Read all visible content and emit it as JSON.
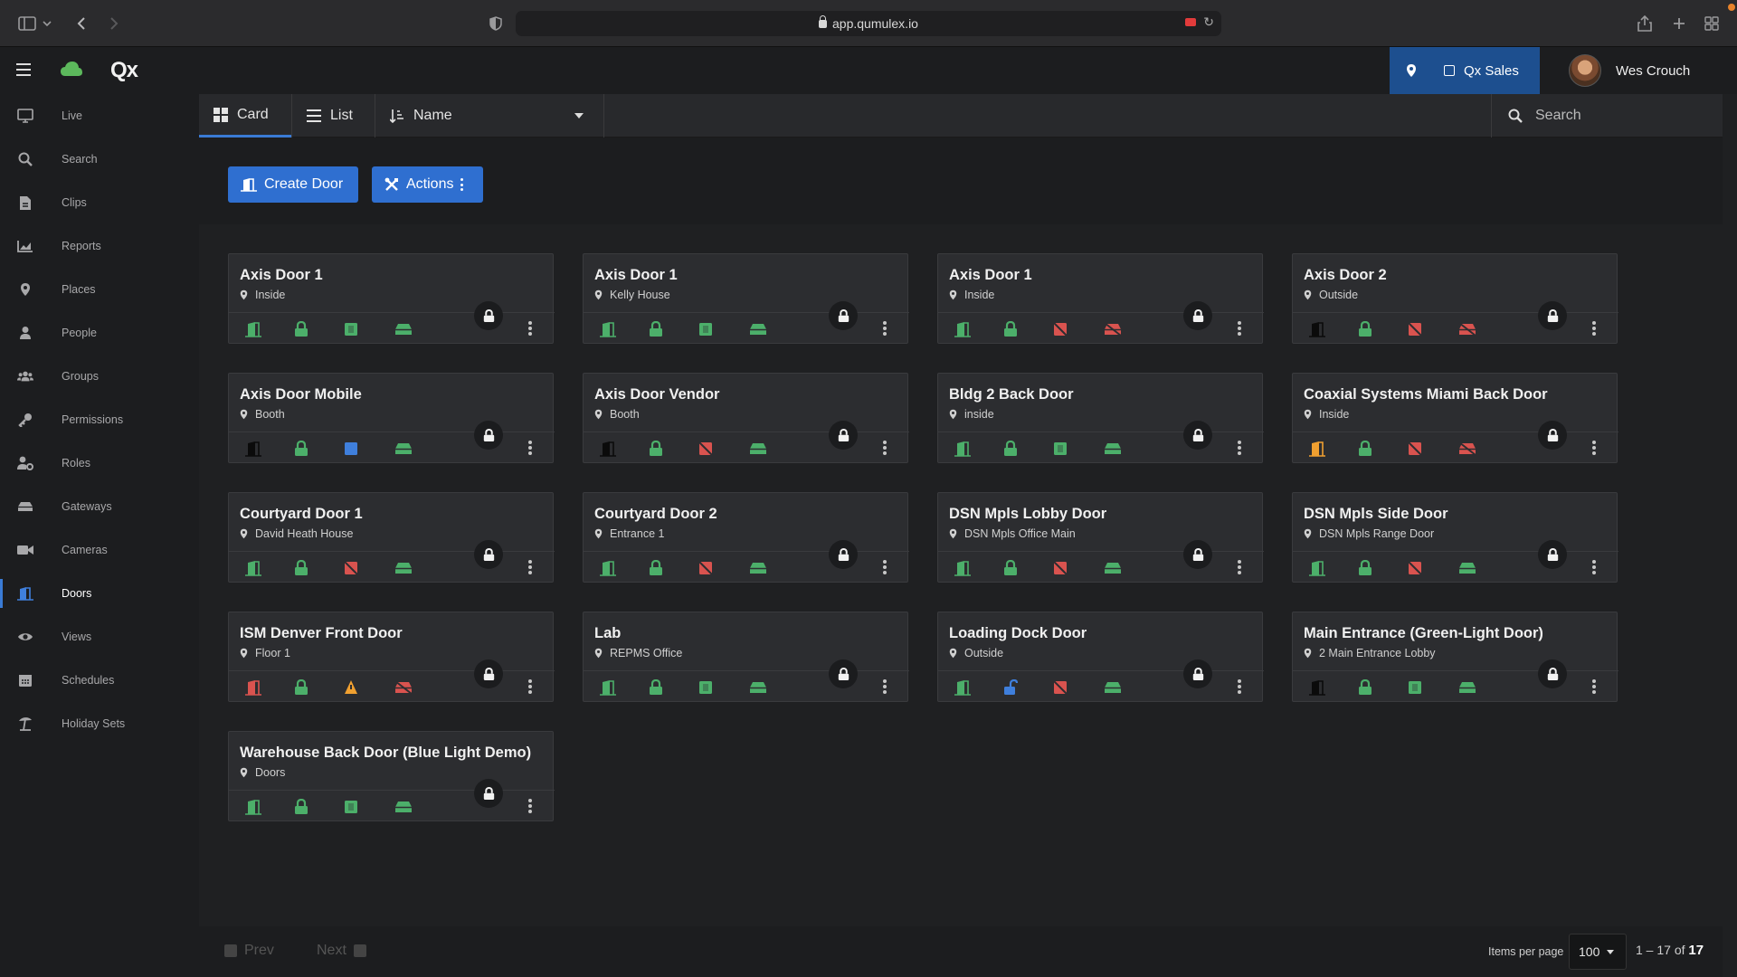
{
  "browser": {
    "url": "app.qumulex.io"
  },
  "app": {
    "logo_text": "Qx",
    "site_button": "Qx Sales",
    "user_name": "Wes Crouch"
  },
  "sidebar": {
    "items": [
      {
        "label": "Live",
        "icon": "monitor-icon"
      },
      {
        "label": "Search",
        "icon": "search-icon"
      },
      {
        "label": "Clips",
        "icon": "file-icon"
      },
      {
        "label": "Reports",
        "icon": "chart-icon"
      },
      {
        "label": "Places",
        "icon": "map-pin-icon"
      },
      {
        "label": "People",
        "icon": "person-icon"
      },
      {
        "label": "Groups",
        "icon": "users-icon"
      },
      {
        "label": "Permissions",
        "icon": "key-icon"
      },
      {
        "label": "Roles",
        "icon": "user-cog-icon"
      },
      {
        "label": "Gateways",
        "icon": "hard-drive-icon"
      },
      {
        "label": "Cameras",
        "icon": "video-camera-icon"
      },
      {
        "label": "Doors",
        "icon": "door-icon",
        "active": true
      },
      {
        "label": "Views",
        "icon": "eye-icon"
      },
      {
        "label": "Schedules",
        "icon": "calendar-icon"
      },
      {
        "label": "Holiday Sets",
        "icon": "beach-umbrella-icon"
      }
    ]
  },
  "toolbar": {
    "card_label": "Card",
    "list_label": "List",
    "sort_label": "Name",
    "search_placeholder": "Search"
  },
  "actions": {
    "create_label": "Create Door",
    "actions_label": "Actions"
  },
  "colors": {
    "green": "#4caf6a",
    "red": "#d9534f",
    "blue": "#3f7fdc",
    "orange": "#f0a030",
    "black": "#0b0b0b",
    "accent": "#2f6fd0"
  },
  "doors": [
    {
      "name": "Axis Door 1",
      "location": "Inside",
      "status": [
        "door-green",
        "lock-green",
        "sensor-green",
        "rex-green"
      ]
    },
    {
      "name": "Axis Door 1",
      "location": "Kelly House",
      "status": [
        "door-green",
        "lock-green",
        "sensor-green",
        "rex-green"
      ]
    },
    {
      "name": "Axis Door 1",
      "location": "Inside",
      "status": [
        "door-green",
        "lock-green",
        "sensor-red",
        "rex-red"
      ]
    },
    {
      "name": "Axis Door 2",
      "location": "Outside",
      "status": [
        "door-black",
        "lock-green",
        "sensor-red",
        "rex-red"
      ]
    },
    {
      "name": "Axis Door Mobile",
      "location": "Booth",
      "status": [
        "door-black",
        "lock-green",
        "sensor-blue",
        "rex-green"
      ]
    },
    {
      "name": "Axis Door Vendor",
      "location": "Booth",
      "status": [
        "door-black",
        "lock-green",
        "sensor-red",
        "rex-green"
      ]
    },
    {
      "name": "Bldg 2 Back Door",
      "location": "inside",
      "status": [
        "door-green",
        "lock-green",
        "sensor-green",
        "rex-green"
      ]
    },
    {
      "name": "Coaxial Systems Miami Back Door",
      "location": "Inside",
      "status": [
        "door-orange",
        "lock-green",
        "sensor-red",
        "rex-red"
      ]
    },
    {
      "name": "Courtyard Door 1",
      "location": "David Heath House",
      "status": [
        "door-green",
        "lock-green",
        "sensor-red",
        "rex-green"
      ]
    },
    {
      "name": "Courtyard Door 2",
      "location": "Entrance 1",
      "status": [
        "door-green",
        "lock-green",
        "sensor-red",
        "rex-green"
      ]
    },
    {
      "name": "DSN Mpls Lobby Door",
      "location": "DSN Mpls Office Main",
      "status": [
        "door-green",
        "lock-green",
        "sensor-red",
        "rex-green"
      ]
    },
    {
      "name": "DSN Mpls Side Door",
      "location": "DSN Mpls Range Door",
      "status": [
        "door-green",
        "lock-green",
        "sensor-red",
        "rex-green"
      ]
    },
    {
      "name": "ISM Denver Front Door",
      "location": "Floor 1",
      "status": [
        "door-red",
        "lock-green",
        "sensor-orange",
        "rex-red"
      ]
    },
    {
      "name": "Lab",
      "location": "REPMS Office",
      "status": [
        "door-green",
        "lock-green",
        "sensor-green",
        "rex-green"
      ]
    },
    {
      "name": "Loading Dock Door",
      "location": "Outside",
      "status": [
        "door-green",
        "unlock-blue",
        "sensor-red",
        "rex-green"
      ]
    },
    {
      "name": "Main Entrance (Green-Light Door)",
      "location": "2 Main Entrance Lobby",
      "status": [
        "door-black",
        "lock-green",
        "sensor-green",
        "rex-green"
      ]
    },
    {
      "name": "Warehouse Back Door (Blue Light Demo)",
      "location": "Doors",
      "status": [
        "door-green",
        "lock-green",
        "sensor-green",
        "rex-green"
      ]
    }
  ],
  "footer": {
    "prev_label": "Prev",
    "next_label": "Next",
    "items_per_page_label": "Items per page",
    "items_per_page_value": "100",
    "range_text": "1 – 17 of ",
    "total": "17"
  }
}
